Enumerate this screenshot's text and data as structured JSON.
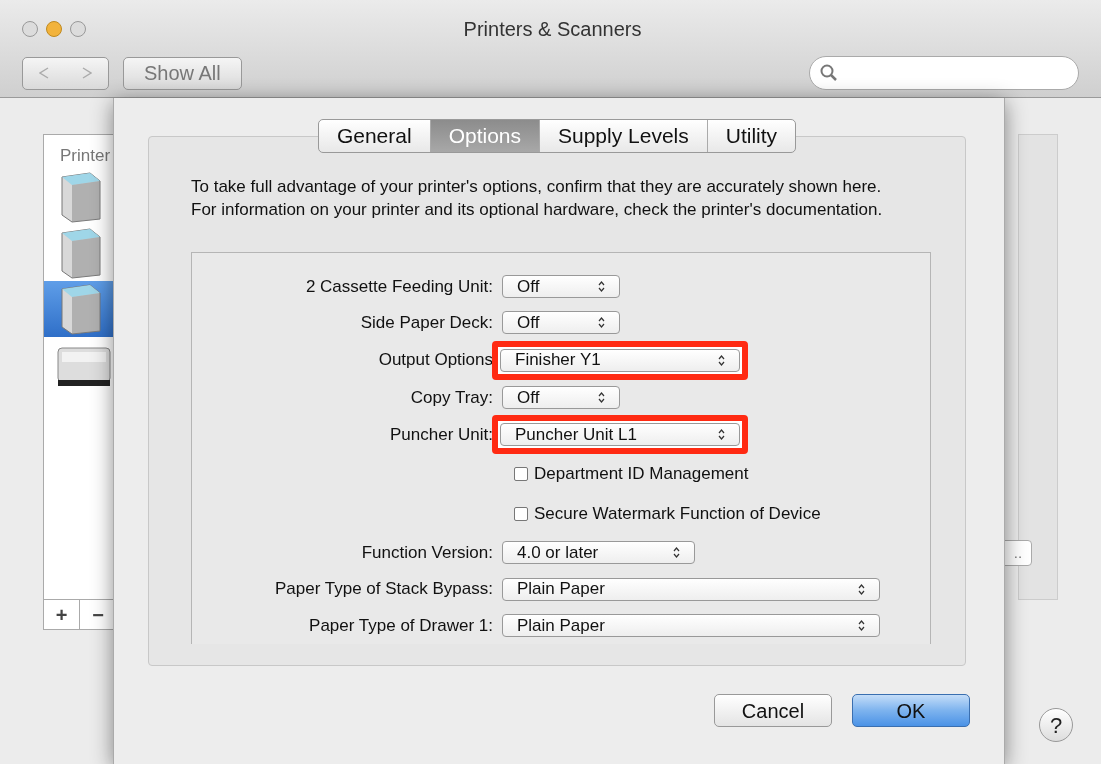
{
  "window": {
    "title": "Printers & Scanners",
    "show_all": "Show All"
  },
  "sidebar": {
    "heading": "Printer",
    "printers": [
      {
        "kind": "tower",
        "selected": false
      },
      {
        "kind": "tower",
        "selected": false
      },
      {
        "kind": "tower",
        "selected": true
      },
      {
        "kind": "desktop",
        "selected": false
      }
    ],
    "add": "+",
    "remove": "−"
  },
  "sharing_button_tail": "..",
  "help": "?",
  "sheet": {
    "tabs": [
      {
        "label": "General",
        "selected": false
      },
      {
        "label": "Options",
        "selected": true
      },
      {
        "label": "Supply Levels",
        "selected": false
      },
      {
        "label": "Utility",
        "selected": false
      }
    ],
    "description": "To take full advantage of your printer's options, confirm that they are accurately shown here. For information on your printer and its optional hardware, check the printer's documentation.",
    "options": [
      {
        "kind": "popup",
        "label": "2 Cassette Feeding Unit:",
        "value": "Off",
        "highlighted": false
      },
      {
        "kind": "popup",
        "label": "Side Paper Deck:",
        "value": "Off",
        "highlighted": false
      },
      {
        "kind": "popup",
        "label": "Output Options",
        "value": "Finisher Y1",
        "highlighted": true
      },
      {
        "kind": "popup",
        "label": "Copy Tray:",
        "value": "Off",
        "highlighted": false
      },
      {
        "kind": "popup",
        "label": "Puncher Unit:",
        "value": "Puncher Unit L1",
        "highlighted": true
      },
      {
        "kind": "checkbox",
        "label": "Department ID Management",
        "checked": false
      },
      {
        "kind": "checkbox",
        "label": "Secure Watermark Function of Device",
        "checked": false
      },
      {
        "kind": "popup",
        "label": "Function Version:",
        "value": "4.0 or later",
        "highlighted": false
      },
      {
        "kind": "popup",
        "label": "Paper Type of Stack Bypass:",
        "value": "Plain Paper",
        "highlighted": false
      },
      {
        "kind": "popup",
        "label": "Paper Type of Drawer 1:",
        "value": "Plain Paper",
        "highlighted": false
      }
    ],
    "buttons": [
      {
        "label": "Cancel",
        "default": false
      },
      {
        "label": "OK",
        "default": true
      }
    ]
  }
}
